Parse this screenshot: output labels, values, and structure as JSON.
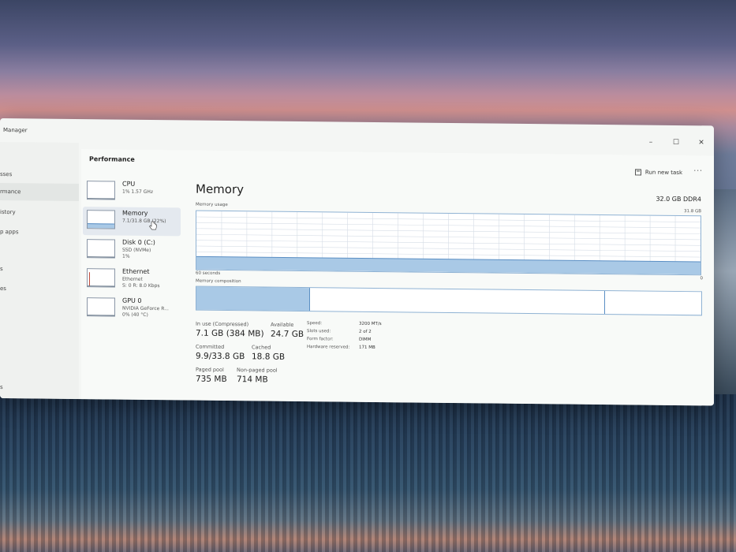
{
  "window": {
    "app_title": "Manager",
    "controls": {
      "minimize": "–",
      "maximize": "☐",
      "close": "✕"
    }
  },
  "nav": {
    "items": [
      {
        "label": "sses"
      },
      {
        "label": "rmance"
      },
      {
        "label": "istory"
      },
      {
        "label": "p apps"
      },
      {
        "label": "s"
      },
      {
        "label": "es"
      },
      {
        "label": "s"
      }
    ]
  },
  "header": {
    "title": "Performance",
    "run_new_task": "Run new task",
    "more": "···"
  },
  "resources": [
    {
      "name": "CPU",
      "sub1": "1%  1.57 GHz",
      "sub2": "",
      "sub3": "",
      "usage": 0.05
    },
    {
      "name": "Memory",
      "sub1": "7.1/31.8 GB (22%)",
      "sub2": "",
      "sub3": "",
      "usage": 0.22
    },
    {
      "name": "Disk 0 (C:)",
      "sub1": "SSD (NVMe)",
      "sub2": "1%",
      "sub3": "",
      "usage": 0.02
    },
    {
      "name": "Ethernet",
      "sub1": "Ethernet",
      "sub2": "S: 0 R: 8.0 Kbps",
      "sub3": "",
      "usage": 0.0
    },
    {
      "name": "GPU 0",
      "sub1": "NVIDIA GeForce R...",
      "sub2": "0% (40 °C)",
      "sub3": "",
      "usage": 0.02
    }
  ],
  "memory": {
    "title": "Memory",
    "total": "32.0 GB DDR4",
    "usage_label": "Memory usage",
    "usage_max": "31.8 GB",
    "time_label": "60 seconds",
    "axis_zero": "0",
    "composition_label": "Memory composition",
    "usage_fraction": 0.22,
    "composition": {
      "in_use": 0.225,
      "available_end": 0.81
    },
    "stats": {
      "in_use_label": "In use (Compressed)",
      "in_use_value": "7.1 GB (384 MB)",
      "available_label": "Available",
      "available_value": "24.7 GB",
      "committed_label": "Committed",
      "committed_value": "9.9/33.8 GB",
      "cached_label": "Cached",
      "cached_value": "18.8 GB",
      "paged_label": "Paged pool",
      "paged_value": "735 MB",
      "nonpaged_label": "Non-paged pool",
      "nonpaged_value": "714 MB"
    },
    "specs": [
      {
        "key": "Speed:",
        "value": "3200 MT/s"
      },
      {
        "key": "Slots used:",
        "value": "2 of 2"
      },
      {
        "key": "Form factor:",
        "value": "DIMM"
      },
      {
        "key": "Hardware reserved:",
        "value": "171 MB"
      }
    ]
  },
  "colors": {
    "accent": "#5b8fc4",
    "fill": "#a9c9e6",
    "ethernet_spike": "#c04a3a"
  }
}
